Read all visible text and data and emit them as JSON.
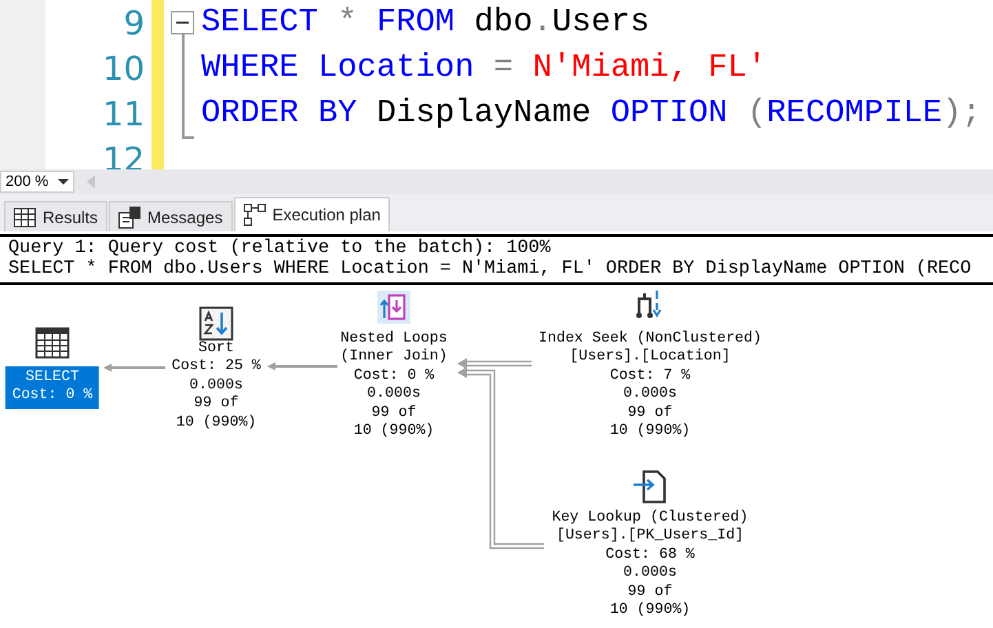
{
  "editor": {
    "lines": [
      {
        "number": "9",
        "fold_start": true,
        "tokens": [
          {
            "kind": "keyword",
            "text": "SELECT "
          },
          {
            "kind": "operator",
            "text": "* "
          },
          {
            "kind": "keyword",
            "text": "FROM "
          },
          {
            "kind": "plain",
            "text": "dbo"
          },
          {
            "kind": "operator",
            "text": "."
          },
          {
            "kind": "plain",
            "text": "Users"
          }
        ]
      },
      {
        "number": "10",
        "fold_start": false,
        "tokens": [
          {
            "kind": "keyword",
            "text": "WHERE "
          },
          {
            "kind": "keyword",
            "text": "Location "
          },
          {
            "kind": "operator",
            "text": "= "
          },
          {
            "kind": "string",
            "text": "N'Miami, FL'"
          }
        ]
      },
      {
        "number": "11",
        "fold_start": false,
        "tokens": [
          {
            "kind": "keyword",
            "text": "ORDER BY"
          },
          {
            "kind": "plain",
            "text": " DisplayName "
          },
          {
            "kind": "keyword",
            "text": "OPTION "
          },
          {
            "kind": "operator",
            "text": "("
          },
          {
            "kind": "keyword",
            "text": "RECOMPILE"
          },
          {
            "kind": "operator",
            "text": ");"
          }
        ]
      },
      {
        "number": "12",
        "fold_start": false
      }
    ]
  },
  "zoom": {
    "value": "200 %"
  },
  "tabs": [
    {
      "label": "Results",
      "kind": "grid",
      "selected": false
    },
    {
      "label": "Messages",
      "kind": "messages",
      "selected": false
    },
    {
      "label": "Execution plan",
      "kind": "plan",
      "selected": true
    }
  ],
  "plan": {
    "header": [
      "Query 1: Query cost (relative to the batch): 100%",
      "SELECT * FROM dbo.Users WHERE Location = N'Miami, FL' ORDER BY DisplayName OPTION (RECO"
    ],
    "nodes": [
      {
        "kind": "select",
        "selected": true,
        "lines": [
          "SELECT",
          "Cost: 0 %"
        ]
      },
      {
        "kind": "sort",
        "selected": false,
        "lines": [
          "Sort",
          "Cost: 25 %",
          "0.000s",
          "99 of",
          "10 (990%)"
        ]
      },
      {
        "kind": "nested_loops",
        "selected": false,
        "lines": [
          "Nested Loops",
          "(Inner Join)",
          "Cost: 0 %",
          "0.000s",
          "99 of",
          "10 (990%)"
        ]
      },
      {
        "kind": "index_seek",
        "selected": false,
        "lines": [
          "Index Seek (NonClustered)",
          "[Users].[Location]",
          "Cost: 7 %",
          "0.000s",
          "99 of",
          "10 (990%)"
        ]
      },
      {
        "kind": "key_lookup",
        "selected": false,
        "lines": [
          "Key Lookup (Clustered)",
          "[Users].[PK_Users_Id]",
          "Cost: 68 %",
          "0.000s",
          "99 of",
          "10 (990%)"
        ]
      }
    ]
  }
}
